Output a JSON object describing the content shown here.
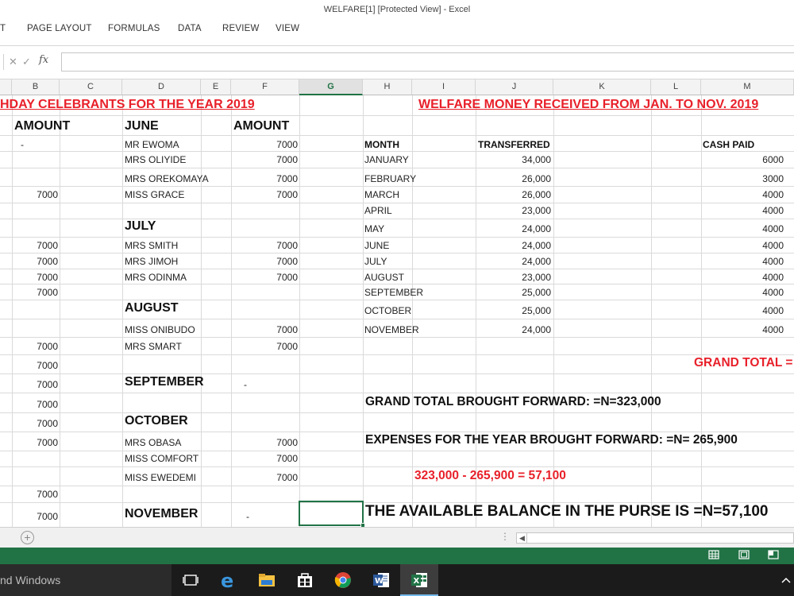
{
  "window": {
    "title": "WELFARE[1]  [Protected View] - Excel"
  },
  "ribbon": {
    "tabs": [
      "T",
      "PAGE LAYOUT",
      "FORMULAS",
      "DATA",
      "REVIEW",
      "VIEW"
    ]
  },
  "formula_bar": {
    "cancel_icon": "x-icon",
    "enter_icon": "check-icon",
    "fx_label": "fx",
    "value": ""
  },
  "columns": [
    "B",
    "C",
    "D",
    "E",
    "F",
    "G",
    "H",
    "I",
    "J",
    "K",
    "L",
    "M"
  ],
  "active_column": "G",
  "left": {
    "title": "HDAY CELEBRANTS FOR THE YEAR 2019",
    "amount_header": "AMOUNT",
    "amount_col": [
      "-",
      "7000",
      "7000",
      "7000",
      "7000",
      "7000",
      "7000",
      "7000",
      "7000",
      "7000",
      "7000",
      "7000",
      "7000",
      "7000"
    ],
    "months": {
      "june": "JUNE",
      "july": "JULY",
      "august": "AUGUST",
      "september": "SEPTEMBER",
      "october": "OCTOBER",
      "november": "NOVEMBER"
    },
    "amount_header2": "AMOUNT",
    "june_names": [
      "MR EWOMA",
      "MRS OLIYIDE",
      "MRS OREKOMAYA",
      "MISS GRACE"
    ],
    "june_amounts": [
      "7000",
      "7000",
      "7000",
      "7000"
    ],
    "july_names": [
      "MRS SMITH",
      "MRS JIMOH",
      "MRS ODINMA"
    ],
    "july_amounts": [
      "7000",
      "7000",
      "7000"
    ],
    "august_names": [
      "MISS ONIBUDO",
      "MRS SMART"
    ],
    "august_amounts": [
      "7000",
      "7000"
    ],
    "september_amount": "-",
    "october_names": [
      "MRS OBASA",
      "MISS COMFORT",
      "MISS EWEDEMI"
    ],
    "october_amounts": [
      "7000",
      "7000",
      "7000"
    ],
    "november_amount": "-"
  },
  "right": {
    "title": "WELFARE MONEY RECEIVED FROM JAN. TO NOV. 2019",
    "headers": {
      "month": "MONTH",
      "transferred": "TRANSFERRED",
      "cash": "CASH PAID"
    },
    "rows": [
      {
        "month": "JANUARY",
        "transferred": "34,000",
        "cash": "6000"
      },
      {
        "month": "FEBRUARY",
        "transferred": "26,000",
        "cash": "3000"
      },
      {
        "month": "MARCH",
        "transferred": "26,000",
        "cash": "4000"
      },
      {
        "month": "APRIL",
        "transferred": "23,000",
        "cash": "4000"
      },
      {
        "month": "MAY",
        "transferred": "24,000",
        "cash": "4000"
      },
      {
        "month": "JUNE",
        "transferred": "24,000",
        "cash": "4000"
      },
      {
        "month": "JULY",
        "transferred": "24,000",
        "cash": "4000"
      },
      {
        "month": "AUGUST",
        "transferred": "23,000",
        "cash": "4000"
      },
      {
        "month": "SEPTEMBER",
        "transferred": "25,000",
        "cash": "4000"
      },
      {
        "month": "OCTOBER",
        "transferred": "25,000",
        "cash": "4000"
      },
      {
        "month": "NOVEMBER",
        "transferred": "24,000",
        "cash": "4000"
      }
    ],
    "grand_total_label": "GRAND TOTAL =",
    "brought_forward": "GRAND TOTAL BROUGHT FORWARD: =N=323,000",
    "expenses": "EXPENSES FOR THE YEAR BROUGHT FORWARD: =N= 265,900",
    "calc": "323,000 - 265,900 = 57,100",
    "balance": "THE AVAILABLE BALANCE IN THE PURSE IS =N=57,100"
  },
  "taskbar": {
    "search_text": "nd Windows"
  },
  "colors": {
    "excel_green": "#217346",
    "red_text": "#e8202a"
  }
}
